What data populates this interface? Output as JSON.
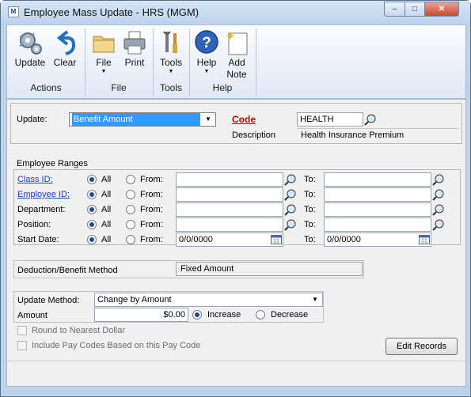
{
  "window": {
    "title": "Employee Mass Update  -  HRS (MGM)",
    "app_icon": "dynamics-gp-icon",
    "min_glyph": "–",
    "max_glyph": "□",
    "close_glyph": "✕"
  },
  "ribbon": {
    "update": "Update",
    "clear": "Clear",
    "file": "File",
    "print": "Print",
    "tools": "Tools",
    "help": "Help",
    "add_note_line1": "Add",
    "add_note_line2": "Note",
    "dropdown_glyph": "▼",
    "groups": {
      "actions": "Actions",
      "file": "File",
      "tools": "Tools",
      "help": "Help"
    }
  },
  "form": {
    "update_label": "Update:",
    "update_value": "Benefit Amount",
    "code_label": "Code",
    "code_value": "HEALTH",
    "description_label": "Description",
    "description_value": "Health Insurance Premium",
    "ranges_title": "Employee Ranges",
    "all_label": "All",
    "from_label": "From:",
    "to_label": "To:",
    "ranges": [
      {
        "label": "Class ID:",
        "from": "",
        "to": ""
      },
      {
        "label": "Employee ID:",
        "from": "",
        "to": ""
      },
      {
        "label": "Department:",
        "from": "",
        "to": ""
      },
      {
        "label": "Position:",
        "from": "",
        "to": ""
      },
      {
        "label": "Start Date:",
        "from": "0/0/0000",
        "to": "0/0/0000"
      }
    ],
    "method_label": "Deduction/Benefit Method",
    "method_value": "Fixed Amount",
    "update_method_label": "Update Method:",
    "update_method_value": "Change by Amount",
    "amount_label": "Amount",
    "amount_value": "$0.00",
    "increase_label": "Increase",
    "decrease_label": "Decrease",
    "round_label": "Round to Nearest Dollar",
    "include_label": "Include Pay Codes Based on this Pay Code",
    "edit_records": "Edit Records"
  },
  "state": {
    "increase_selected": true,
    "all_selected": true,
    "round_checked": false,
    "include_checked": false
  }
}
